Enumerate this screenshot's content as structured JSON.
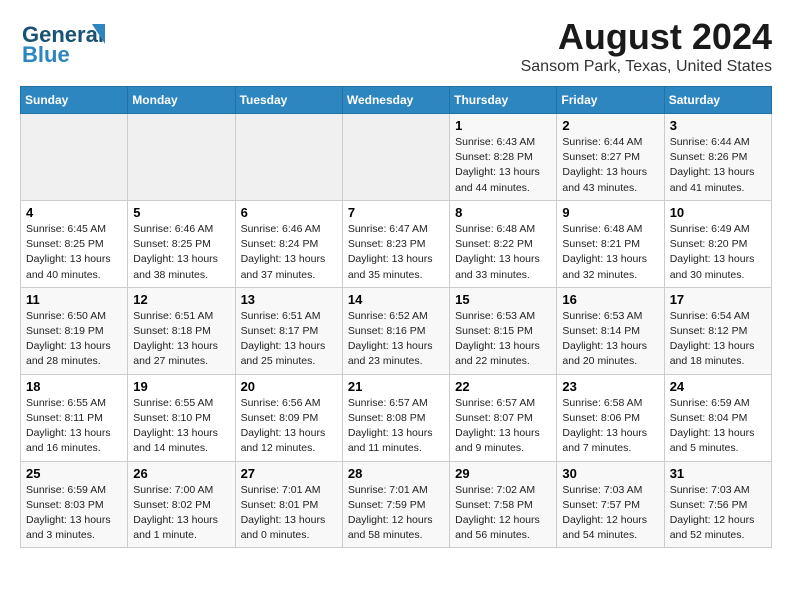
{
  "header": {
    "logo_line1": "General",
    "logo_line2": "Blue",
    "title": "August 2024",
    "subtitle": "Sansom Park, Texas, United States"
  },
  "days_of_week": [
    "Sunday",
    "Monday",
    "Tuesday",
    "Wednesday",
    "Thursday",
    "Friday",
    "Saturday"
  ],
  "weeks": [
    [
      {
        "day": "",
        "info": ""
      },
      {
        "day": "",
        "info": ""
      },
      {
        "day": "",
        "info": ""
      },
      {
        "day": "",
        "info": ""
      },
      {
        "day": "1",
        "info": "Sunrise: 6:43 AM\nSunset: 8:28 PM\nDaylight: 13 hours\nand 44 minutes."
      },
      {
        "day": "2",
        "info": "Sunrise: 6:44 AM\nSunset: 8:27 PM\nDaylight: 13 hours\nand 43 minutes."
      },
      {
        "day": "3",
        "info": "Sunrise: 6:44 AM\nSunset: 8:26 PM\nDaylight: 13 hours\nand 41 minutes."
      }
    ],
    [
      {
        "day": "4",
        "info": "Sunrise: 6:45 AM\nSunset: 8:25 PM\nDaylight: 13 hours\nand 40 minutes."
      },
      {
        "day": "5",
        "info": "Sunrise: 6:46 AM\nSunset: 8:25 PM\nDaylight: 13 hours\nand 38 minutes."
      },
      {
        "day": "6",
        "info": "Sunrise: 6:46 AM\nSunset: 8:24 PM\nDaylight: 13 hours\nand 37 minutes."
      },
      {
        "day": "7",
        "info": "Sunrise: 6:47 AM\nSunset: 8:23 PM\nDaylight: 13 hours\nand 35 minutes."
      },
      {
        "day": "8",
        "info": "Sunrise: 6:48 AM\nSunset: 8:22 PM\nDaylight: 13 hours\nand 33 minutes."
      },
      {
        "day": "9",
        "info": "Sunrise: 6:48 AM\nSunset: 8:21 PM\nDaylight: 13 hours\nand 32 minutes."
      },
      {
        "day": "10",
        "info": "Sunrise: 6:49 AM\nSunset: 8:20 PM\nDaylight: 13 hours\nand 30 minutes."
      }
    ],
    [
      {
        "day": "11",
        "info": "Sunrise: 6:50 AM\nSunset: 8:19 PM\nDaylight: 13 hours\nand 28 minutes."
      },
      {
        "day": "12",
        "info": "Sunrise: 6:51 AM\nSunset: 8:18 PM\nDaylight: 13 hours\nand 27 minutes."
      },
      {
        "day": "13",
        "info": "Sunrise: 6:51 AM\nSunset: 8:17 PM\nDaylight: 13 hours\nand 25 minutes."
      },
      {
        "day": "14",
        "info": "Sunrise: 6:52 AM\nSunset: 8:16 PM\nDaylight: 13 hours\nand 23 minutes."
      },
      {
        "day": "15",
        "info": "Sunrise: 6:53 AM\nSunset: 8:15 PM\nDaylight: 13 hours\nand 22 minutes."
      },
      {
        "day": "16",
        "info": "Sunrise: 6:53 AM\nSunset: 8:14 PM\nDaylight: 13 hours\nand 20 minutes."
      },
      {
        "day": "17",
        "info": "Sunrise: 6:54 AM\nSunset: 8:12 PM\nDaylight: 13 hours\nand 18 minutes."
      }
    ],
    [
      {
        "day": "18",
        "info": "Sunrise: 6:55 AM\nSunset: 8:11 PM\nDaylight: 13 hours\nand 16 minutes."
      },
      {
        "day": "19",
        "info": "Sunrise: 6:55 AM\nSunset: 8:10 PM\nDaylight: 13 hours\nand 14 minutes."
      },
      {
        "day": "20",
        "info": "Sunrise: 6:56 AM\nSunset: 8:09 PM\nDaylight: 13 hours\nand 12 minutes."
      },
      {
        "day": "21",
        "info": "Sunrise: 6:57 AM\nSunset: 8:08 PM\nDaylight: 13 hours\nand 11 minutes."
      },
      {
        "day": "22",
        "info": "Sunrise: 6:57 AM\nSunset: 8:07 PM\nDaylight: 13 hours\nand 9 minutes."
      },
      {
        "day": "23",
        "info": "Sunrise: 6:58 AM\nSunset: 8:06 PM\nDaylight: 13 hours\nand 7 minutes."
      },
      {
        "day": "24",
        "info": "Sunrise: 6:59 AM\nSunset: 8:04 PM\nDaylight: 13 hours\nand 5 minutes."
      }
    ],
    [
      {
        "day": "25",
        "info": "Sunrise: 6:59 AM\nSunset: 8:03 PM\nDaylight: 13 hours\nand 3 minutes."
      },
      {
        "day": "26",
        "info": "Sunrise: 7:00 AM\nSunset: 8:02 PM\nDaylight: 13 hours\nand 1 minute."
      },
      {
        "day": "27",
        "info": "Sunrise: 7:01 AM\nSunset: 8:01 PM\nDaylight: 13 hours\nand 0 minutes."
      },
      {
        "day": "28",
        "info": "Sunrise: 7:01 AM\nSunset: 7:59 PM\nDaylight: 12 hours\nand 58 minutes."
      },
      {
        "day": "29",
        "info": "Sunrise: 7:02 AM\nSunset: 7:58 PM\nDaylight: 12 hours\nand 56 minutes."
      },
      {
        "day": "30",
        "info": "Sunrise: 7:03 AM\nSunset: 7:57 PM\nDaylight: 12 hours\nand 54 minutes."
      },
      {
        "day": "31",
        "info": "Sunrise: 7:03 AM\nSunset: 7:56 PM\nDaylight: 12 hours\nand 52 minutes."
      }
    ]
  ]
}
